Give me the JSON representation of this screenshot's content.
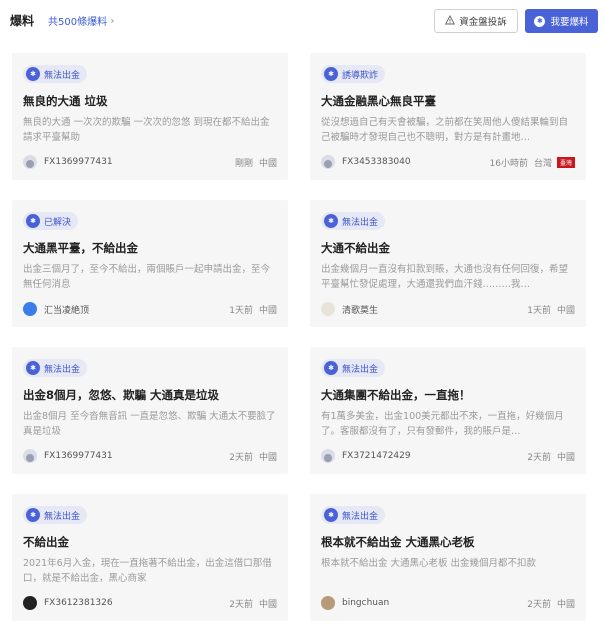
{
  "header": {
    "title": "爆料",
    "count": "共500條爆料",
    "complaint_button": "資金盤投訴",
    "report_button": "我要爆料"
  },
  "cards": [
    {
      "badge": "無法出金",
      "title": "無良的大通 垃圾",
      "desc": "無良的大通 一次次的欺騙 一次次的忽悠 到現在都不給出金 請求平臺幫助",
      "user": "FX1369977431",
      "time": "剛剛",
      "region": "中國"
    },
    {
      "badge": "誘導欺詐",
      "title": "大通金融黑心無良平臺",
      "desc": "從沒想過自己有天會被騙，之前都在笑周他人傻結果輪到自己被騙時才發現自己也不聰明，對方是有計畫地…",
      "user": "FX3453383040",
      "time": "16小時前",
      "region": "台灣",
      "flag": "臺灣"
    },
    {
      "badge": "已解決",
      "title": "大通黑平臺，不給出金",
      "desc": "出金三個月了，至今不給出，兩個賬戶一起申請出金，至今無任何消息",
      "user": "汇当凌絶顶",
      "time": "1天前",
      "region": "中國"
    },
    {
      "badge": "無法出金",
      "title": "大通不給出金",
      "desc": "出金幾個月一直沒有扣款到賬，大通也沒有任何回復，希望平臺幫忙發促處理，大通還我們血汗錢………我…",
      "user": "清歌莫生",
      "time": "1天前",
      "region": "中國"
    },
    {
      "badge": "無法出金",
      "title": "出金8個月，忽悠、欺騙 大通真是垃圾",
      "desc": "出金8個月 至今沓無音訊 一直是忽悠、欺騙 大通太不要臉了 真是垃圾",
      "user": "FX1369977431",
      "time": "2天前",
      "region": "中國"
    },
    {
      "badge": "無法出金",
      "title": "大通集團不給出金，一直拖！",
      "desc": "有1萬多美金，出金100美元都出不來，一直拖，好幾個月了。客服都沒有了，只有發郵件，我的賬戶是…",
      "user": "FX3721472429",
      "time": "2天前",
      "region": "中國"
    },
    {
      "badge": "無法出金",
      "title": "不給出金",
      "desc": "2021年6月入金，現在一直拖著不給出金，出金這借口那借口，就是不給出金，黑心商家",
      "user": "FX3612381326",
      "time": "2天前",
      "region": "中國"
    },
    {
      "badge": "無法出金",
      "title": "根本就不給出金 大通黑心老板",
      "desc": "根本就不給出金 大通黑心老板 出金幾個月都不扣款",
      "user": "bingchuan",
      "time": "2天前",
      "region": "中國"
    }
  ]
}
